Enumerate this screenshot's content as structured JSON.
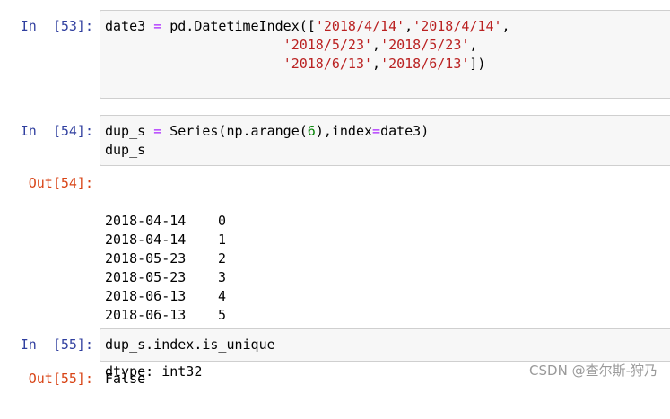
{
  "cells": [
    {
      "prompt": "In  [53]:",
      "code": {
        "l1_a": "date3 ",
        "l1_op": "=",
        "l1_b": " pd.DatetimeIndex([",
        "l1_s1": "'2018/4/14'",
        "l1_c1": ",",
        "l1_s2": "'2018/4/14'",
        "l1_c2": ",",
        "l2_indent": "                      ",
        "l2_s1": "'2018/5/23'",
        "l2_c1": ",",
        "l2_s2": "'2018/5/23'",
        "l2_c2": ",",
        "l3_indent": "                      ",
        "l3_s1": "'2018/6/13'",
        "l3_c1": ",",
        "l3_s2": "'2018/6/13'",
        "l3_end": "])"
      }
    },
    {
      "prompt": "In  [54]:",
      "code": {
        "l1_a": "dup_s ",
        "l1_op": "=",
        "l1_b": " Series(np.arange(",
        "l1_num": "6",
        "l1_c": "),index",
        "l1_op2": "=",
        "l1_d": "date3)",
        "l2": "dup_s"
      },
      "out_prompt": "Out[54]:",
      "output_rows": [
        {
          "date": "2018-04-14",
          "value": "0"
        },
        {
          "date": "2018-04-14",
          "value": "1"
        },
        {
          "date": "2018-05-23",
          "value": "2"
        },
        {
          "date": "2018-05-23",
          "value": "3"
        },
        {
          "date": "2018-06-13",
          "value": "4"
        },
        {
          "date": "2018-06-13",
          "value": "5"
        }
      ],
      "dtype": "dtype: int32"
    },
    {
      "prompt": "In  [55]:",
      "code": {
        "l1": "dup_s.index.is_unique"
      },
      "out_prompt": "Out[55]:",
      "output": "False"
    }
  ],
  "watermark": "CSDN @查尔斯-狩乃"
}
